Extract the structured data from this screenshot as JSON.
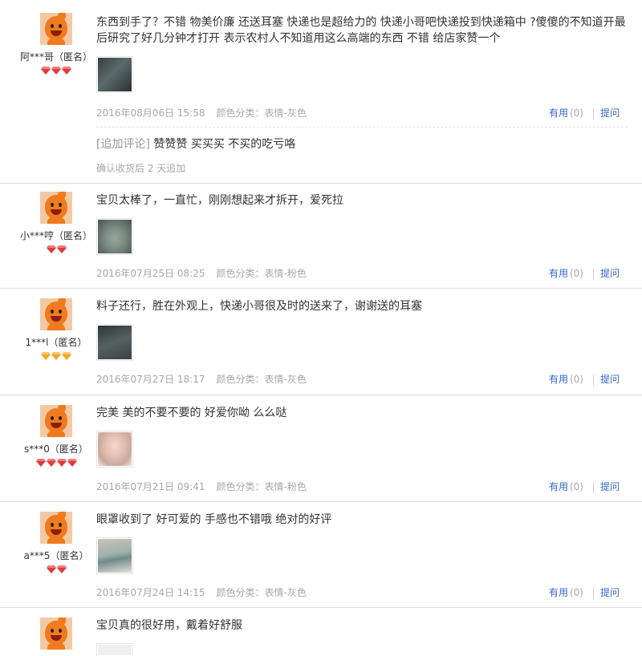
{
  "colors": {
    "link": "#3366cc",
    "meta": "#a8a8a8",
    "text": "#333333",
    "border": "#dddddd",
    "gem_red": "#e4393c",
    "gem_gold": "#f5a623"
  },
  "reviews": [
    {
      "user": "阿***哥（匿名）",
      "rank": {
        "gem_color": "red",
        "count": 3
      },
      "content": "东西到手了？不错 物美价廉 还送耳塞 快递也是超给力的 快递小哥吧快递投到快递箱中 ?傻傻的不知道开最后研究了好几分钟才打开 表示农村人不知道用这么高端的东西 不错 给店家赞一个",
      "thumb_icon": "photo-thumbnail",
      "date": "2016年08月06日 15:58",
      "spec": "颜色分类：表情-灰色",
      "useful_label": "有用",
      "useful_count": "(0)",
      "ask_label": "提问",
      "append": {
        "tag": "[追加评论]",
        "text": "赞赞赞 买买买 不买的吃亏咯",
        "time": "确认收货后 2 天追加"
      }
    },
    {
      "user": "小***哼（匿名）",
      "rank": {
        "gem_color": "red",
        "count": 2
      },
      "content": "宝贝太棒了，一直忙，刚刚想起来才拆开，爱死拉",
      "thumb_icon": "photo-thumbnail",
      "date": "2016年07月25日 08:25",
      "spec": "颜色分类：表情-粉色",
      "useful_label": "有用",
      "useful_count": "(0)",
      "ask_label": "提问"
    },
    {
      "user": "1***l（匿名）",
      "rank": {
        "gem_color": "gold",
        "count": 3
      },
      "content": "料子还行，胜在外观上，快递小哥很及时的送来了，谢谢送的耳塞",
      "thumb_icon": "photo-thumbnail",
      "date": "2016年07月27日 18:17",
      "spec": "颜色分类：表情-灰色",
      "useful_label": "有用",
      "useful_count": "(0)",
      "ask_label": "提问"
    },
    {
      "user": "s***0（匿名）",
      "rank": {
        "gem_color": "red",
        "count": 4
      },
      "content": "完美 美的不要不要的 好爱你呦 么么哒",
      "thumb_icon": "photo-thumbnail",
      "date": "2016年07月21日 09:41",
      "spec": "颜色分类：表情-粉色",
      "useful_label": "有用",
      "useful_count": "(0)",
      "ask_label": "提问"
    },
    {
      "user": "a***5（匿名）",
      "rank": {
        "gem_color": "red",
        "count": 2
      },
      "content": "眼罩收到了 好可爱的 手感也不错哦 绝对的好评",
      "thumb_icon": "photo-thumbnail",
      "date": "2016年07月24日 14:15",
      "spec": "颜色分类：表情-灰色",
      "useful_label": "有用",
      "useful_count": "(0)",
      "ask_label": "提问"
    },
    {
      "user": "",
      "rank": {
        "gem_color": "red",
        "count": 0
      },
      "content": "宝贝真的很好用，戴着好舒服"
    }
  ]
}
